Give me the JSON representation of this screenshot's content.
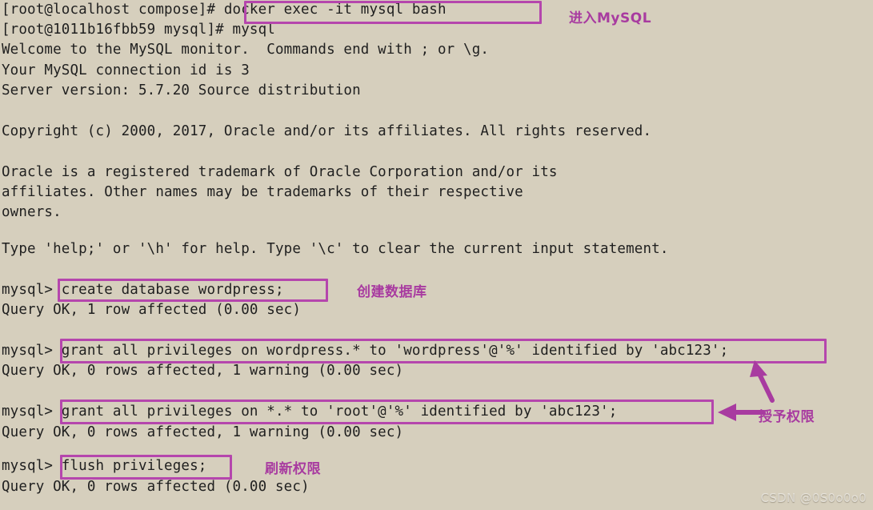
{
  "terminal": {
    "background_color": "#d6cfbd",
    "text_color": "#1f1f1f",
    "highlight_color": "#b546ad",
    "annotation_color": "#a83ba0",
    "lines": [
      {
        "text": "[root@localhost compose]# docker exec -it mysql bash"
      },
      {
        "text": "[root@1011b16fbb59 mysql]# mysql"
      },
      {
        "text": "Welcome to the MySQL monitor.  Commands end with ; or \\g."
      },
      {
        "text": "Your MySQL connection id is 3"
      },
      {
        "text": "Server version: 5.7.20 Source distribution"
      },
      {
        "text": ""
      },
      {
        "text": "Copyright (c) 2000, 2017, Oracle and/or its affiliates. All rights reserved."
      },
      {
        "text": ""
      },
      {
        "text": "Oracle is a registered trademark of Oracle Corporation and/or its"
      },
      {
        "text": "affiliates. Other names may be trademarks of their respective"
      },
      {
        "text": "owners."
      },
      {
        "text": ""
      },
      {
        "text": "Type 'help;' or '\\h' for help. Type '\\c' to clear the current input statement."
      },
      {
        "text": ""
      },
      {
        "text": "mysql> create database wordpress;"
      },
      {
        "text": "Query OK, 1 row affected (0.00 sec)"
      },
      {
        "text": ""
      },
      {
        "text": "mysql> grant all privileges on wordpress.* to 'wordpress'@'%' identified by 'abc123';"
      },
      {
        "text": "Query OK, 0 rows affected, 1 warning (0.00 sec)"
      },
      {
        "text": ""
      },
      {
        "text": "mysql> grant all privileges on *.* to 'root'@'%' identified by 'abc123';"
      },
      {
        "text": "Query OK, 0 rows affected, 1 warning (0.00 sec)"
      },
      {
        "text": ""
      },
      {
        "text": "mysql> flush privileges;"
      },
      {
        "text": "Query OK, 0 rows affected (0.00 sec)"
      }
    ],
    "highlights": [
      {
        "name": "docker-exec-command",
        "command": "docker exec -it mysql bash"
      },
      {
        "name": "create-database-command",
        "command": "create database wordpress;"
      },
      {
        "name": "grant-wordpress-command",
        "command": "grant all privileges on wordpress.* to 'wordpress'@'%' identified by 'abc123';"
      },
      {
        "name": "grant-root-command",
        "command": "grant all privileges on *.* to 'root'@'%' identified by 'abc123';"
      },
      {
        "name": "flush-privileges-command",
        "command": "flush privileges;"
      }
    ]
  },
  "annotations": {
    "enter_mysql": "进入MySQL",
    "create_database": "创建数据库",
    "grant_privileges": "授予权限",
    "flush_privileges": "刷新权限"
  },
  "watermark": {
    "text": "CSDN @0S0o0o0"
  }
}
